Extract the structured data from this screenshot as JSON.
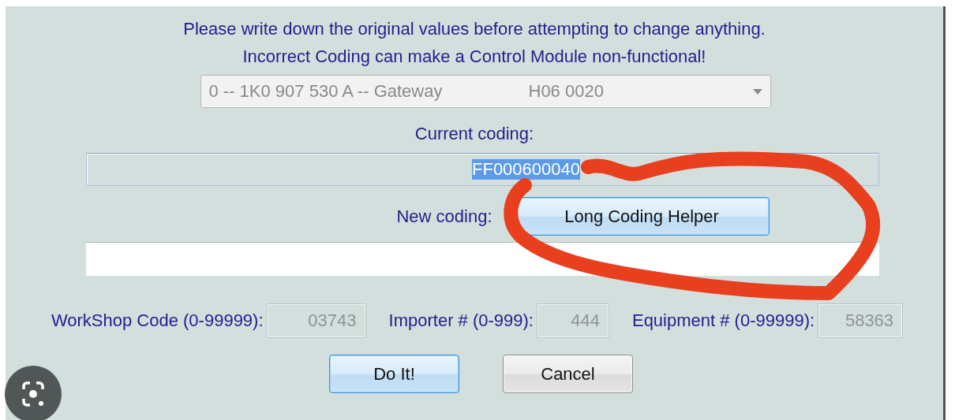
{
  "notice": [
    "Please write down the original values before attempting to change anything.",
    "Incorrect Coding can make a Control Module non-functional!"
  ],
  "module_select": {
    "value": "0 -- 1K0 907 530 A -- Gateway",
    "version": "H06 0020",
    "disabled": true
  },
  "current_coding": {
    "label": "Current coding:",
    "value": "FF000600040",
    "selected": true
  },
  "new_coding": {
    "label": "New coding:",
    "helper_button": "Long Coding Helper"
  },
  "codes": [
    {
      "label": "WorkShop Code (0-99999):",
      "value": "03743",
      "disabled": true
    },
    {
      "label": "Importer # (0-999):",
      "value": "444",
      "disabled": true
    },
    {
      "label": "Equipment # (0-99999):",
      "value": "58363",
      "disabled": true
    }
  ],
  "buttons": [
    {
      "label": "Do It!",
      "kind": "primary"
    },
    {
      "label": "Cancel",
      "kind": "secondary"
    }
  ],
  "annotation": {
    "kind": "scribble",
    "color": "#e8401f"
  }
}
